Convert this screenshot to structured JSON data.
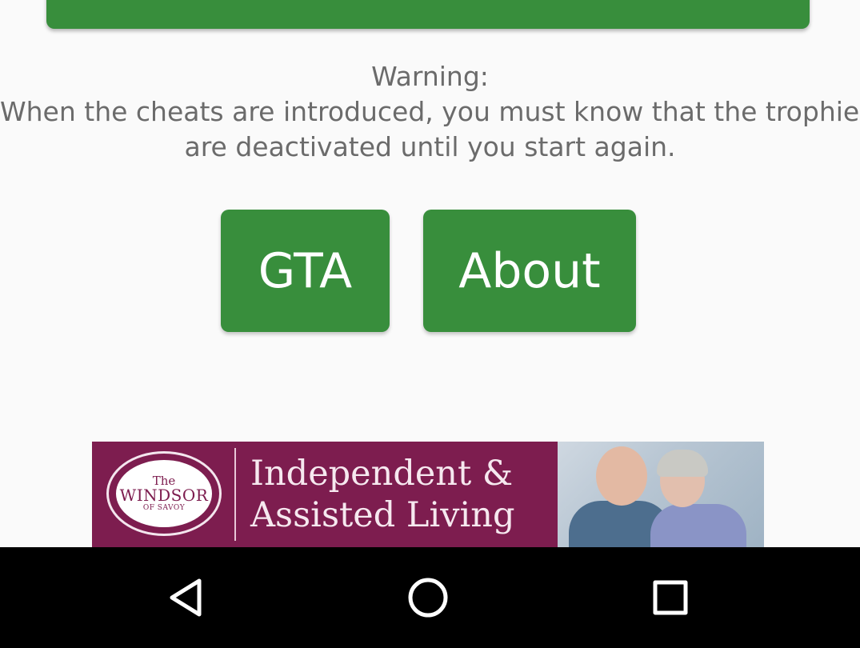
{
  "warning": {
    "line1": "Warning:",
    "line2": "When the cheats are introduced, you must know that the trophies",
    "line3": "are deactivated until you start again."
  },
  "buttons": {
    "gta_label": "GTA",
    "about_label": "About"
  },
  "ad": {
    "logo_line1": "The",
    "logo_line2": "WINDSOR",
    "logo_line3": "OF SAVOY",
    "headline_line1": "Independent &",
    "headline_line2": "Assisted Living"
  },
  "navbar": {
    "back_icon": "triangle-back-icon",
    "home_icon": "circle-home-icon",
    "recent_icon": "square-recents-icon"
  },
  "colors": {
    "accent_green": "#388e3c",
    "ad_maroon": "#7d1d4f",
    "background": "#fafafa",
    "text_gray": "#6b6b6b",
    "navbar": "#000000"
  }
}
